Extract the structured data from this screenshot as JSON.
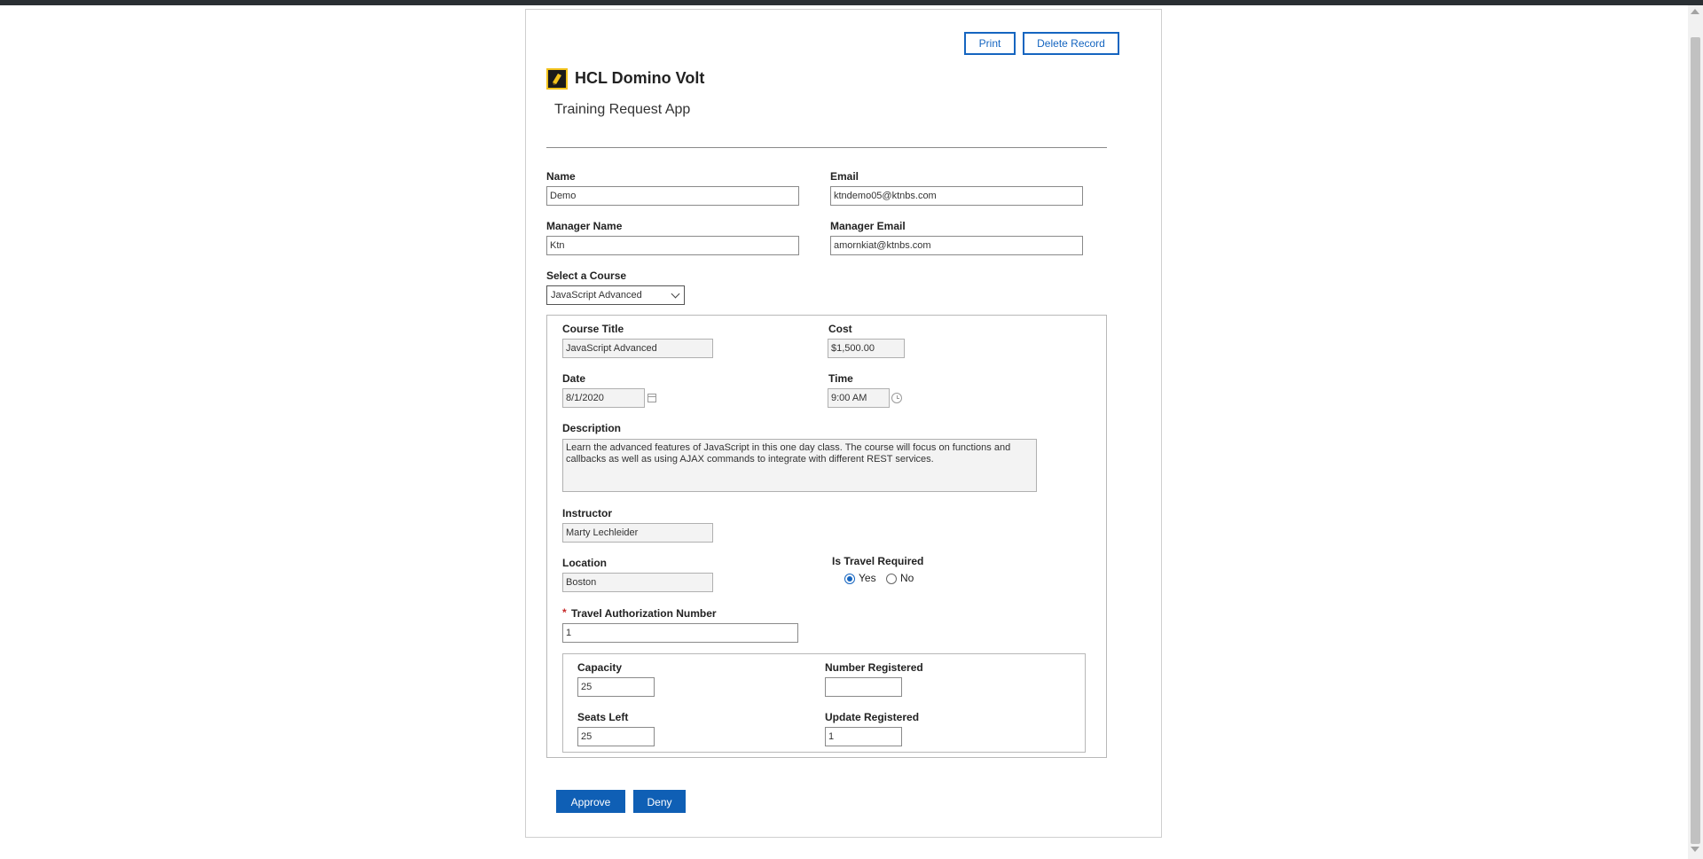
{
  "toolbar": {
    "print_label": "Print",
    "delete_label": "Delete Record"
  },
  "header": {
    "title": "HCL Domino Volt",
    "subtitle": "Training Request App"
  },
  "colors": {
    "accent": "#1565c0",
    "primary_button": "#0f5fb5",
    "required": "#c62828"
  },
  "form": {
    "name": {
      "label": "Name",
      "value": "Demo"
    },
    "email": {
      "label": "Email",
      "value": "ktndemo05@ktnbs.com"
    },
    "manager_name": {
      "label": "Manager Name",
      "value": "Ktn"
    },
    "manager_email": {
      "label": "Manager Email",
      "value": "amornkiat@ktnbs.com"
    },
    "course_select": {
      "label": "Select a Course",
      "value": "JavaScript Advanced"
    },
    "course": {
      "title": {
        "label": "Course Title",
        "value": "JavaScript Advanced"
      },
      "cost": {
        "label": "Cost",
        "value": "$1,500.00"
      },
      "date": {
        "label": "Date",
        "value": "8/1/2020"
      },
      "time": {
        "label": "Time",
        "value": "9:00 AM"
      },
      "description": {
        "label": "Description",
        "value": "Learn the advanced features of JavaScript in this one day class.  The course will focus on functions and callbacks as well as using AJAX commands to integrate with different REST services."
      },
      "instructor": {
        "label": "Instructor",
        "value": "Marty Lechleider"
      },
      "location": {
        "label": "Location",
        "value": "Boston"
      },
      "travel_required": {
        "label": "Is Travel Required",
        "yes": "Yes",
        "no": "No",
        "selected": "Yes"
      },
      "travel_auth": {
        "required_mark": "*",
        "label": "Travel Authorization Number",
        "value": "1"
      },
      "capacity": {
        "label": "Capacity",
        "value": "25"
      },
      "number_registered": {
        "label": "Number Registered",
        "value": ""
      },
      "seats_left": {
        "label": "Seats Left",
        "value": "25"
      },
      "update_registered": {
        "label": "Update Registered",
        "value": "1"
      }
    }
  },
  "actions": {
    "approve_label": "Approve",
    "deny_label": "Deny"
  }
}
